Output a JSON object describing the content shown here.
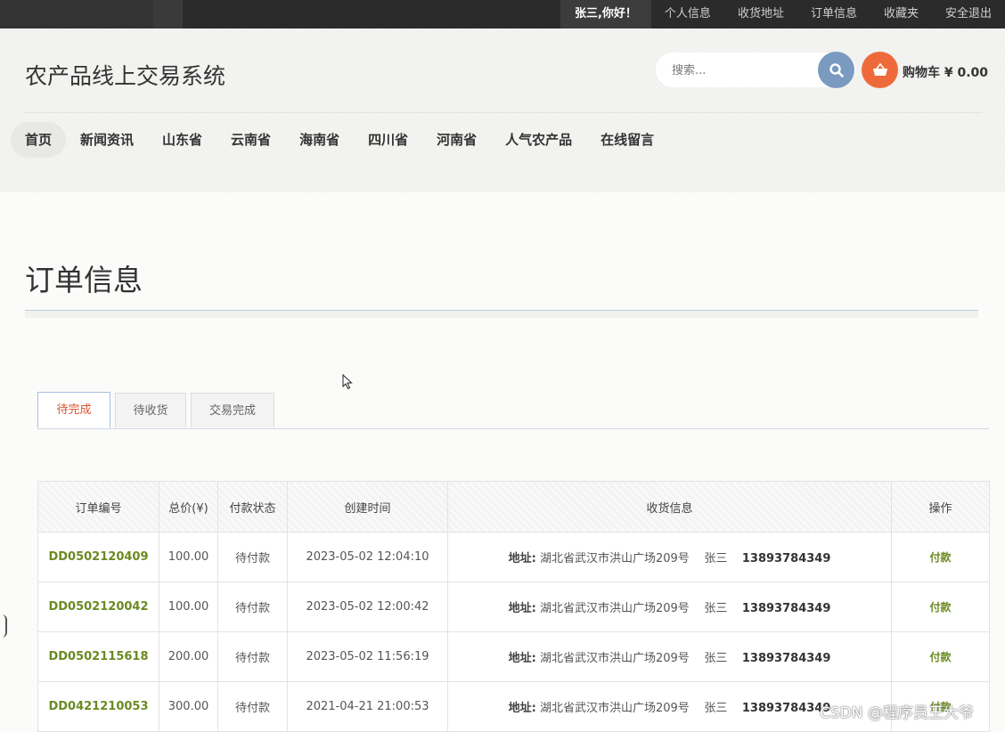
{
  "topbar": {
    "greeting": "张三,你好！",
    "links": [
      "个人信息",
      "收货地址",
      "订单信息",
      "收藏夹",
      "安全退出"
    ]
  },
  "header": {
    "site_title": "农产品线上交易系统",
    "search_placeholder": "搜索...",
    "cart_label": "购物车 ¥ 0.00"
  },
  "nav": {
    "items": [
      "首页",
      "新闻资讯",
      "山东省",
      "云南省",
      "海南省",
      "四川省",
      "河南省",
      "人气农产品",
      "在线留言"
    ],
    "active_index": 0
  },
  "page": {
    "title": "订单信息",
    "tabs": [
      "待完成",
      "待收货",
      "交易完成"
    ],
    "active_tab": 0
  },
  "table": {
    "headers": [
      "订单编号",
      "总价(¥)",
      "付款状态",
      "创建时间",
      "收货信息",
      "操作"
    ],
    "rows": [
      {
        "id": "DD0502120409",
        "total": "100.00",
        "status": "待付款",
        "created": "2023-05-02 12:04:10",
        "addr_label": "地址:",
        "addr": "湖北省武汉市洪山广场209号",
        "name": "张三",
        "phone": "13893784349",
        "action": "付款"
      },
      {
        "id": "DD0502120042",
        "total": "100.00",
        "status": "待付款",
        "created": "2023-05-02 12:00:42",
        "addr_label": "地址:",
        "addr": "湖北省武汉市洪山广场209号",
        "name": "张三",
        "phone": "13893784349",
        "action": "付款"
      },
      {
        "id": "DD0502115618",
        "total": "200.00",
        "status": "待付款",
        "created": "2023-05-02 11:56:19",
        "addr_label": "地址:",
        "addr": "湖北省武汉市洪山广场209号",
        "name": "张三",
        "phone": "13893784349",
        "action": "付款"
      },
      {
        "id": "DD0421210053",
        "total": "300.00",
        "status": "待付款",
        "created": "2021-04-21 21:00:53",
        "addr_label": "地址:",
        "addr": "湖北省武汉市洪山广场209号",
        "name": "张三",
        "phone": "13893784349",
        "action": "付款"
      }
    ]
  },
  "watermark": "CSDN @程序员王大爷",
  "colors": {
    "topbar_bg": "#2b2b2b",
    "search_button": "#7b9ac0",
    "cart_button": "#ef6a3a",
    "active_tab_text": "#d9542c",
    "order_id_text": "#6b8a22"
  }
}
